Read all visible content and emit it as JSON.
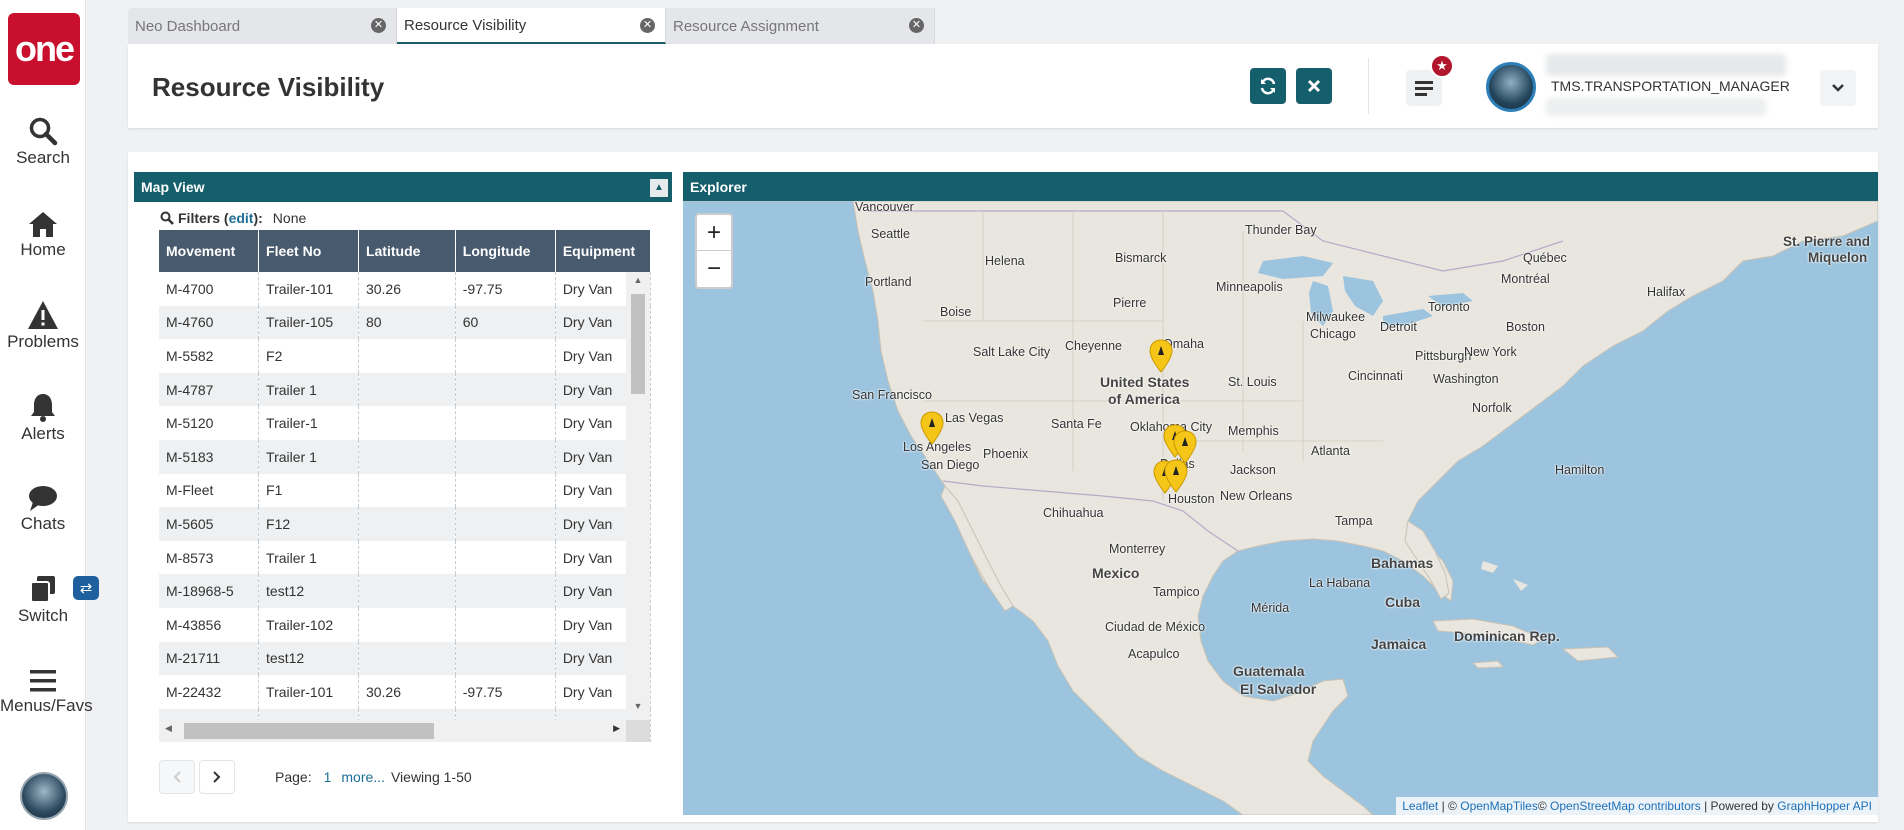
{
  "app": {
    "logo_text": "one",
    "brand_color": "#c8102e",
    "accent_color": "#155e6b"
  },
  "nav": {
    "search": "Search",
    "home": "Home",
    "problems": "Problems",
    "alerts": "Alerts",
    "chats": "Chats",
    "switch": "Switch",
    "menus": "Menus/Favs"
  },
  "tabs": [
    {
      "label": "Neo Dashboard"
    },
    {
      "label": "Resource Visibility"
    },
    {
      "label": "Resource Assignment"
    }
  ],
  "header": {
    "title": "Resource Visibility",
    "user_role": "TMS.TRANSPORTATION_MANAGER"
  },
  "map_view": {
    "title": "Map View",
    "filters_label": "Filters",
    "filters_edit": "edit",
    "filters_value": "None",
    "columns": [
      "Movement",
      "Fleet No",
      "Latitude",
      "Longitude",
      "Equipment"
    ],
    "rows": [
      [
        "M-4700",
        "Trailer-101",
        "30.26",
        "-97.75",
        "Dry Van"
      ],
      [
        "M-4760",
        "Trailer-105",
        "80",
        "60",
        "Dry Van"
      ],
      [
        "M-5582",
        "F2",
        "",
        "",
        "Dry Van"
      ],
      [
        "M-4787",
        "Trailer 1",
        "",
        "",
        "Dry Van"
      ],
      [
        "M-5120",
        "Trailer-1",
        "",
        "",
        "Dry Van"
      ],
      [
        "M-5183",
        "Trailer 1",
        "",
        "",
        "Dry Van"
      ],
      [
        "M-Fleet",
        "F1",
        "",
        "",
        "Dry Van"
      ],
      [
        "M-5605",
        "F12",
        "",
        "",
        "Dry Van"
      ],
      [
        "M-8573",
        "Trailer 1",
        "",
        "",
        "Dry Van"
      ],
      [
        "M-18968-5",
        "test12",
        "",
        "",
        "Dry Van"
      ],
      [
        "M-43856",
        "Trailer-102",
        "",
        "",
        "Dry Van"
      ],
      [
        "M-21711",
        "test12",
        "",
        "",
        "Dry Van"
      ],
      [
        "M-22432",
        "Trailer-101",
        "30.26",
        "-97.75",
        "Dry Van"
      ],
      [
        "",
        "",
        "",
        "",
        ""
      ]
    ],
    "pager": {
      "page_label": "Page:",
      "page": "1",
      "more": "more...",
      "viewing": "Viewing 1-50"
    }
  },
  "explorer": {
    "title": "Explorer",
    "zoom_in": "+",
    "zoom_out": "−",
    "attribution": {
      "leaflet": "Leaflet",
      "sep1": " | © ",
      "omt": "OpenMapTiles",
      "sep2": "© ",
      "osm": "OpenStreetMap contributors",
      "sep3": " | Powered by ",
      "gh": "GraphHopper API"
    },
    "labels": {
      "vancouver": "Vancouver",
      "seattle": "Seattle",
      "portland": "Portland",
      "helena": "Helena",
      "boise": "Boise",
      "bismarck": "Bismarck",
      "pierre": "Pierre",
      "minneapolis": "Minneapolis",
      "thunder_bay": "Thunder Bay",
      "quebec": "Québec",
      "montreal": "Montréal",
      "halifax": "Halifax",
      "st_pierre": "St. Pierre and",
      "miquelon": "Miquelon",
      "toronto": "Toronto",
      "milwaukee": "Milwaukee",
      "chicago": "Chicago",
      "detroit": "Detroit",
      "boston": "Boston",
      "pittsburgh": "Pittsburgh",
      "new_york": "New York",
      "cincinnati": "Cincinnati",
      "washington": "Washington",
      "norfolk": "Norfolk",
      "cheyenne": "Cheyenne",
      "omaha": "Omaha",
      "salt_lake": "Salt Lake City",
      "usa1": "United States",
      "usa2": "of America",
      "st_louis": "St. Louis",
      "san_francisco": "San Francisco",
      "las_vegas": "Las Vegas",
      "santa_fe": "Santa Fe",
      "oklahoma": "Oklahoma City",
      "memphis": "Memphis",
      "atlanta": "Atlanta",
      "los_angeles": "Los Angeles",
      "phoenix": "Phoenix",
      "dallas": "Dallas",
      "san_diego": "San Diego",
      "jackson": "Jackson",
      "houston": "Houston",
      "new_orleans": "New Orleans",
      "hamilton": "Hamilton",
      "chihuahua": "Chihuahua",
      "tampa": "Tampa",
      "monterrey": "Monterrey",
      "mexico": "Mexico",
      "bahamas": "Bahamas",
      "tampico": "Tampico",
      "la_habana": "La Habana",
      "cuba": "Cuba",
      "merida": "Mérida",
      "ciudad_mexico": "Ciudad de México",
      "jamaica": "Jamaica",
      "dominican": "Dominican Rep.",
      "acapulco": "Acapulco",
      "guatemala": "Guatemala",
      "el_salvador": "El Salvador"
    }
  }
}
